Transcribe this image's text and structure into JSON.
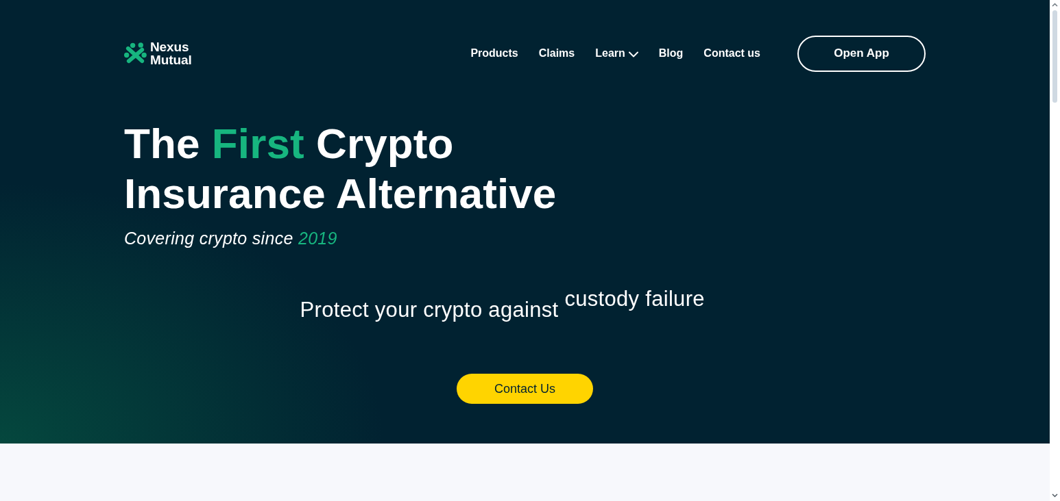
{
  "logo": {
    "lines": [
      "Nexus",
      "Mutual"
    ]
  },
  "nav": {
    "links": [
      {
        "label": "Products",
        "dropdown": false
      },
      {
        "label": "Claims",
        "dropdown": false
      },
      {
        "label": "Learn",
        "dropdown": true
      },
      {
        "label": "Blog",
        "dropdown": false
      },
      {
        "label": "Contact us",
        "dropdown": false
      }
    ],
    "open_app_button": {
      "label": "Open App"
    }
  },
  "hero": {
    "headline": [
      {
        "text": "The ",
        "highlight": false
      },
      {
        "text": "First",
        "highlight": true
      },
      {
        "text": " Crypto Insurance Alternative",
        "highlight": false
      }
    ],
    "subtitle": [
      {
        "text": "Covering crypto since ",
        "highlight": false
      },
      {
        "text": "2019",
        "highlight": true
      }
    ],
    "tagline": {
      "lead": "Protect your crypto against",
      "rotating_word": "custody failure"
    },
    "cta_button": {
      "label": "Contact Us"
    }
  }
}
